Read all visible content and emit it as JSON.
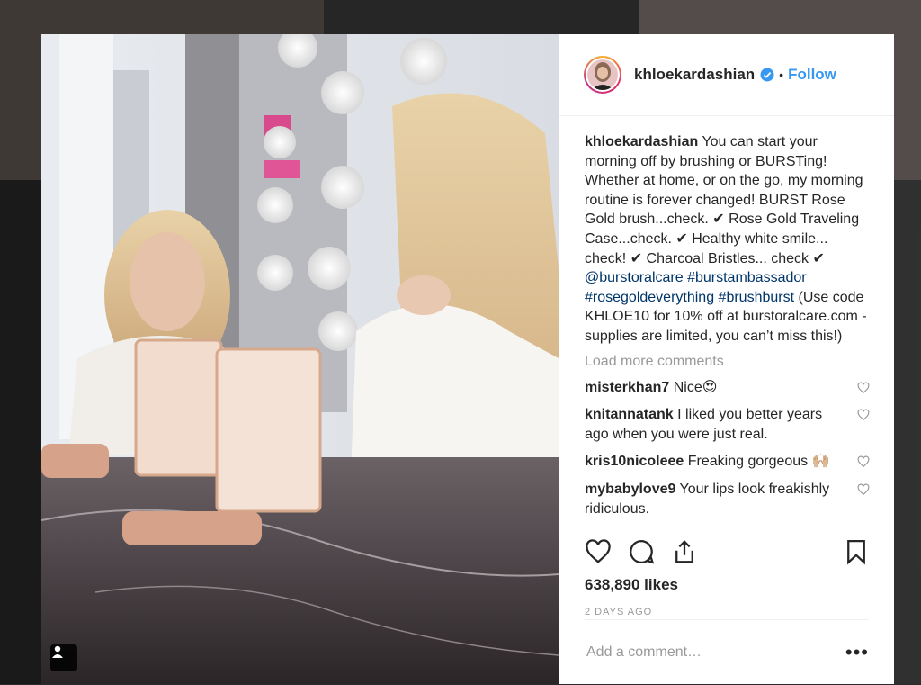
{
  "post": {
    "username": "khloekardashian",
    "follow_label": "Follow",
    "separator": "•",
    "caption": {
      "username": "khloekardashian",
      "text_1": " You can start your morning off by brushing or BURSTing! Whether at home, or on the go, my morning routine is forever changed! BURST Rose Gold brush...check. ✔  Rose Gold Traveling Case...check. ✔  Healthy white smile... check! ✔  Charcoal Bristles... check ✔ ",
      "mention": "@burstoralcare",
      "tag_1": "#burstambassador",
      "tag_2": "#rosegoldeverything",
      "tag_3": "#brushburst",
      "text_2": " (Use code KHLOE10 for 10% off at burstoralcare.com - supplies are limited, you can’t miss this!)"
    },
    "load_more": "Load more comments",
    "comments": [
      {
        "user": "misterkhan7",
        "text": " Nice😍"
      },
      {
        "user": "knitannatank",
        "text": " I liked you better years ago when you were just real."
      },
      {
        "user": "kris10nicoleee",
        "text": " Freaking gorgeous 🙌🏼"
      },
      {
        "user": "mybabylove9",
        "text": " Your lips look freakishly ridiculous."
      }
    ],
    "likes": "638,890 likes",
    "timestamp": "2 DAYS AGO",
    "add_comment_placeholder": "Add a comment…",
    "more_label": "•••"
  },
  "icons": {
    "like": "heart-icon",
    "comment": "comment-icon",
    "share": "share-icon",
    "save": "bookmark-icon",
    "verified": "verified-badge-icon",
    "tag": "user-tag-icon"
  },
  "colors": {
    "link": "#003569",
    "follow": "#3897f0",
    "verified": "#3897f0",
    "muted": "#999999"
  }
}
